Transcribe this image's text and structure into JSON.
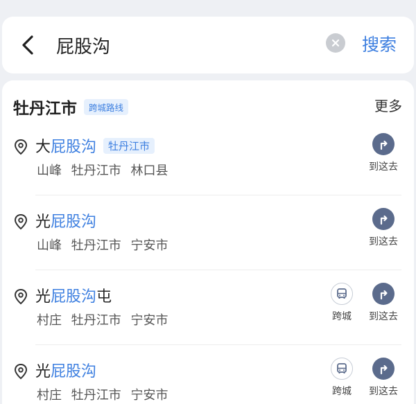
{
  "search": {
    "query": "屁股沟",
    "submit_label": "搜索"
  },
  "header": {
    "city": "牡丹江市",
    "tag": "跨城路线",
    "more": "更多"
  },
  "results": [
    {
      "prefix": "大",
      "highlight": "屁股沟",
      "suffix": "",
      "badge": "牡丹江市",
      "type": "山峰",
      "city": "牡丹江市",
      "district": "林口县",
      "go_label": "到这去"
    },
    {
      "prefix": "光",
      "highlight": "屁股沟",
      "suffix": "",
      "badge": "",
      "type": "山峰",
      "city": "牡丹江市",
      "district": "宁安市",
      "go_label": "到这去"
    },
    {
      "prefix": "光",
      "highlight": "屁股沟",
      "suffix": "屯",
      "badge": "",
      "type": "村庄",
      "city": "牡丹江市",
      "district": "宁安市",
      "bus_label": "跨城",
      "go_label": "到这去"
    },
    {
      "prefix": "光",
      "highlight": "屁股沟",
      "suffix": "",
      "badge": "",
      "type": "村庄",
      "city": "牡丹江市",
      "district": "宁安市",
      "bus_label": "跨城",
      "go_label": "到这去"
    }
  ],
  "colors": {
    "accent": "#3d7fe0",
    "go_button": "#5b6b8c",
    "background": "#eef0f4"
  },
  "icons": {
    "back": "chevron-left-icon",
    "clear": "clear-circle-icon",
    "pin": "location-pin-icon",
    "bus": "bus-icon",
    "navigate": "turn-arrow-icon"
  }
}
